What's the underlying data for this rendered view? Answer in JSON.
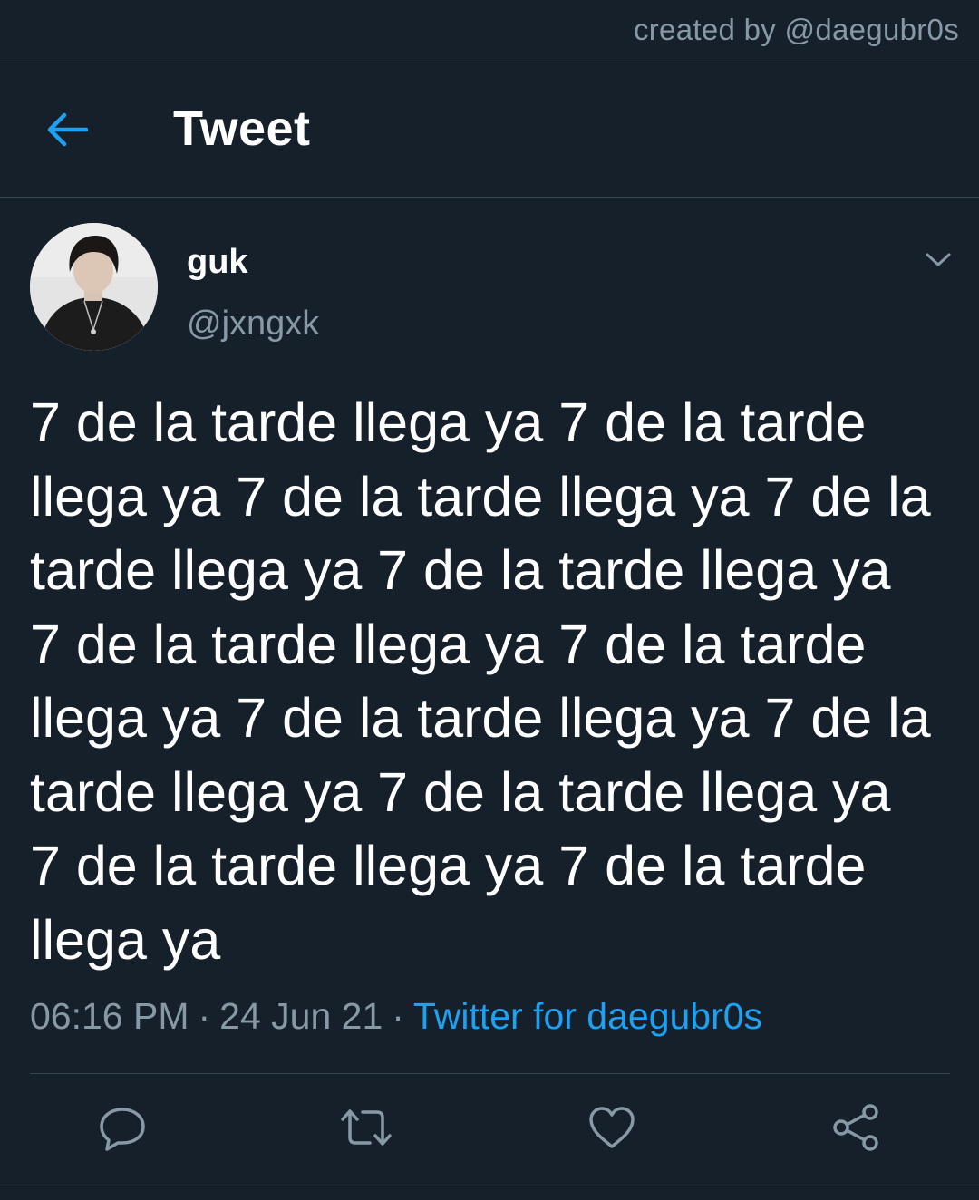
{
  "credit": "created by @daegubr0s",
  "header": {
    "title": "Tweet",
    "back_icon": "arrow-left-icon",
    "accent": "#1da1f2"
  },
  "author": {
    "display_name": "guk",
    "handle": "@jxngxk"
  },
  "tweet": {
    "text": "7 de la tarde llega ya 7 de la tarde llega ya 7 de la tarde llega ya 7 de la tarde llega ya 7 de la tarde llega ya 7 de la tarde llega ya 7 de la tarde llega ya 7 de la tarde llega ya 7 de la tarde llega ya 7 de la tarde llega ya 7 de la tarde llega ya 7 de la tarde llega ya",
    "time": "06:16 PM",
    "separator": "·",
    "date": "24 Jun 21",
    "source": "Twitter for daegubr0s"
  },
  "actions": {
    "reply_icon": "reply-icon",
    "retweet_icon": "retweet-icon",
    "like_icon": "heart-icon",
    "share_icon": "share-icon"
  },
  "colors": {
    "background": "#15202b",
    "secondary_text": "#8899a6",
    "divider": "#38444d",
    "link": "#1da1f2"
  }
}
